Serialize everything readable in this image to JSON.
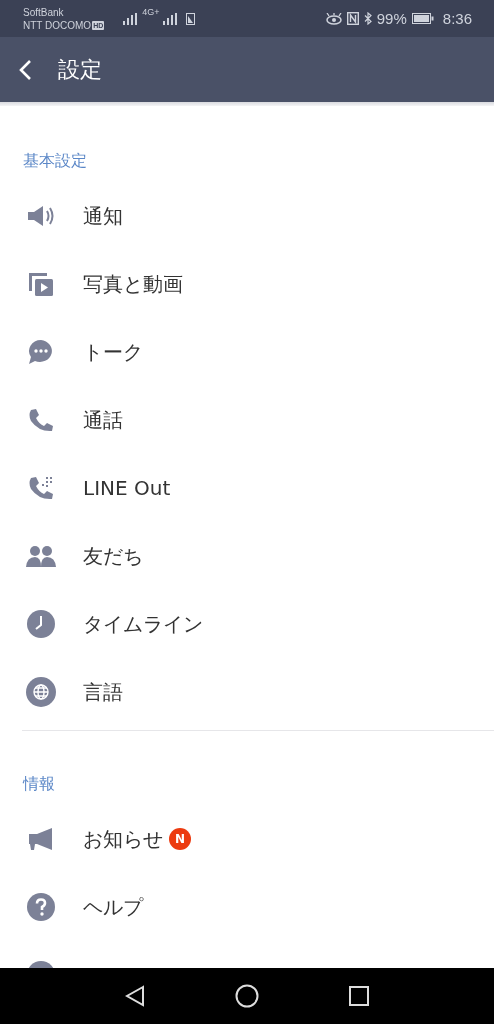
{
  "status_bar": {
    "carrier_1": "SoftBank",
    "carrier_2": "NTT DOCOMO",
    "hd_badge": "HD",
    "network": "4G+",
    "battery": "99%",
    "time": "8:36"
  },
  "header": {
    "title": "設定"
  },
  "sections": [
    {
      "title": "基本設定",
      "items": [
        {
          "label": "通知"
        },
        {
          "label": "写真と動画"
        },
        {
          "label": "トーク"
        },
        {
          "label": "通話"
        },
        {
          "label": "LINE Out"
        },
        {
          "label": "友だち"
        },
        {
          "label": "タイムライン"
        },
        {
          "label": "言語"
        }
      ]
    },
    {
      "title": "情報",
      "items": [
        {
          "label": "お知らせ",
          "badge": "N"
        },
        {
          "label": "ヘルプ"
        }
      ]
    }
  ]
}
